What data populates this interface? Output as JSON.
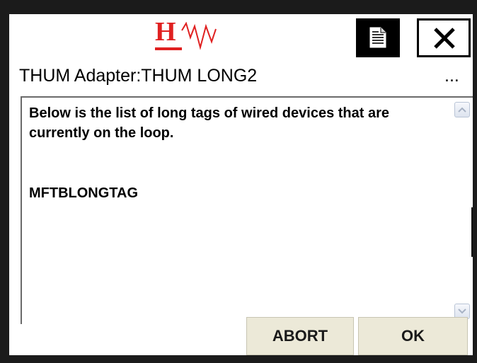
{
  "header": {
    "logo_letter": "H",
    "logo_color": "#e02020",
    "doc_button_icon": "document-icon",
    "close_button_icon": "close-icon"
  },
  "title": {
    "text": "THUM Adapter:THUM LONG2",
    "overflow": "..."
  },
  "content": {
    "message": "Below is the list of long tags of wired devices that are currently on the loop.",
    "tags": [
      "MFTBLONGTAG"
    ]
  },
  "buttons": {
    "abort_label": "ABORT",
    "ok_label": "OK"
  },
  "colors": {
    "button_face": "#ece9d8",
    "frame": "#1b1b1b"
  }
}
